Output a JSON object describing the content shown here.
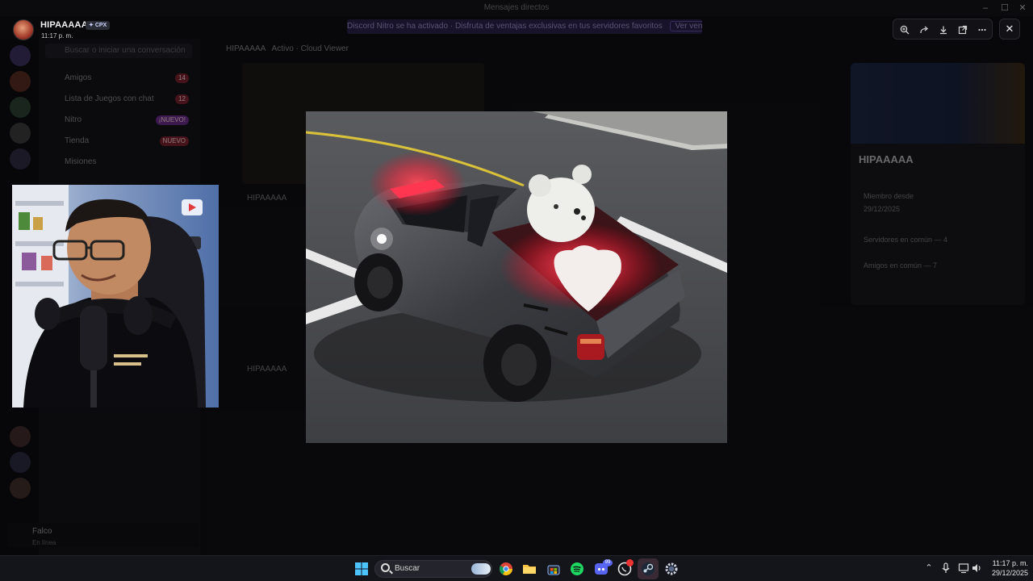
{
  "window": {
    "title": "Mensajes directos",
    "controls": [
      "–",
      "☐",
      "✕"
    ]
  },
  "viewer": {
    "author_name": "HIPAAAAA",
    "author_tag": "CPX",
    "timestamp": "11:17 p. m.",
    "tools": [
      "zoom-in-icon",
      "forward-icon",
      "download-icon",
      "open-external-icon",
      "more-icon"
    ],
    "close_label": "✕"
  },
  "background_app": {
    "notice": "Discord Nitro se ha activado · Disfruta de ventajas exclusivas en tus servidores favoritos",
    "notice_button": "Ver ventajas",
    "search_placeholder": "Buscar o iniciar una conversación",
    "nav": [
      {
        "label": "Amigos",
        "badge": "14"
      },
      {
        "label": "Lista de Juegos con chat",
        "badge": "12"
      },
      {
        "label": "Nitro",
        "badge": "¡NUEVO!"
      },
      {
        "label": "Tienda",
        "badge": "NUEVO"
      },
      {
        "label": "Misiones",
        "badge": ""
      }
    ],
    "channel_name": "HIPAAAAA",
    "channel_status": "Activo · Cloud Viewer",
    "chat_lines": [
      "HIPAAAAA",
      "HIPAAAAA"
    ],
    "profile_name": "HIPAAAAA",
    "profile_lines": [
      "Miembro desde",
      "29/12/2025",
      "Servidores en común — 4",
      "Amigos en común — 7"
    ],
    "user_name": "Falco",
    "user_status": "En línea"
  },
  "taskbar": {
    "search_label": "Buscar",
    "time": "11:17 p. m.",
    "date": "29/12/2025",
    "discord_badge": "99"
  },
  "colors": {
    "accent": "#5865f2",
    "overlay": "#050506",
    "taskbar": "#14141b"
  }
}
